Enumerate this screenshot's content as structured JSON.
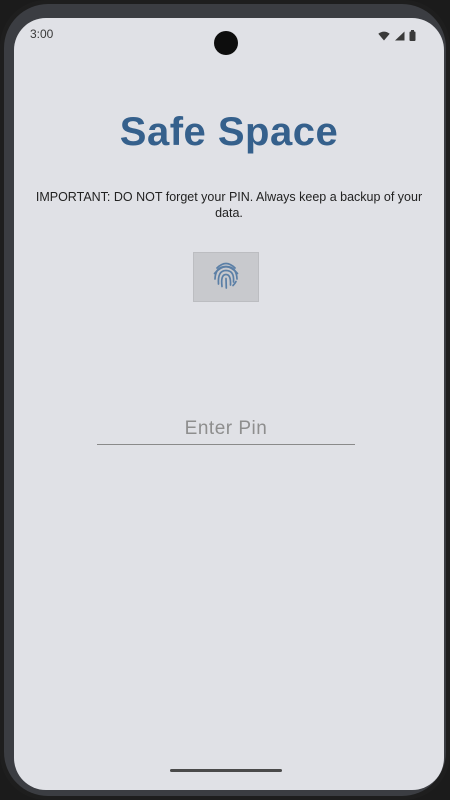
{
  "status_bar": {
    "time": "3:00",
    "icons": [
      "wifi-icon",
      "signal-icon",
      "battery-icon"
    ]
  },
  "app": {
    "title": "Safe Space",
    "warning_text": "IMPORTANT: DO NOT forget your PIN. Always keep a backup of your data.",
    "fingerprint_button_icon": "fingerprint-icon",
    "pin_input": {
      "value": "",
      "placeholder": "Enter Pin"
    }
  },
  "colors": {
    "title": "#35608c",
    "screen_background": "#e0e1e6",
    "fingerprint_icon": "#5b7fa6"
  }
}
